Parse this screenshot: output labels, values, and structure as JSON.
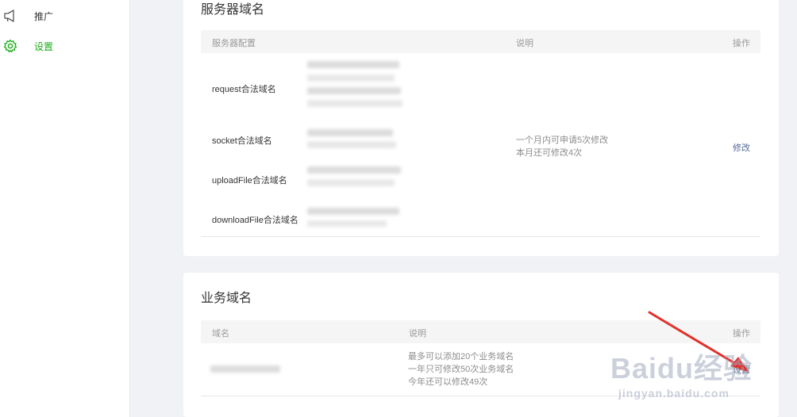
{
  "sidebar": {
    "items": [
      {
        "label": "推广",
        "icon": "megaphone-icon"
      },
      {
        "label": "设置",
        "icon": "gear-icon",
        "active": true
      }
    ]
  },
  "server_domain": {
    "title": "服务器域名",
    "columns": [
      "服务器配置",
      "说明",
      "操作"
    ],
    "rows": [
      {
        "label": "request合法域名"
      },
      {
        "label": "socket合法域名"
      },
      {
        "label": "uploadFile合法域名"
      },
      {
        "label": "downloadFile合法域名"
      }
    ],
    "desc_lines": [
      "一个月内可申请5次修改",
      "本月还可修改4次"
    ],
    "action": "修改"
  },
  "business_domain": {
    "title": "业务域名",
    "columns": [
      "域名",
      "说明",
      "操作"
    ],
    "desc_lines": [
      "最多可以添加20个业务域名",
      "一年只可修改50次业务域名",
      "今年还可以修改49次"
    ],
    "action": "设置"
  },
  "watermark": {
    "line1": "Baidu经验",
    "line2": "jingyan.baidu.com"
  },
  "colors": {
    "accent": "#1aad19",
    "link": "#576b95",
    "arrow": "#e0312b"
  }
}
